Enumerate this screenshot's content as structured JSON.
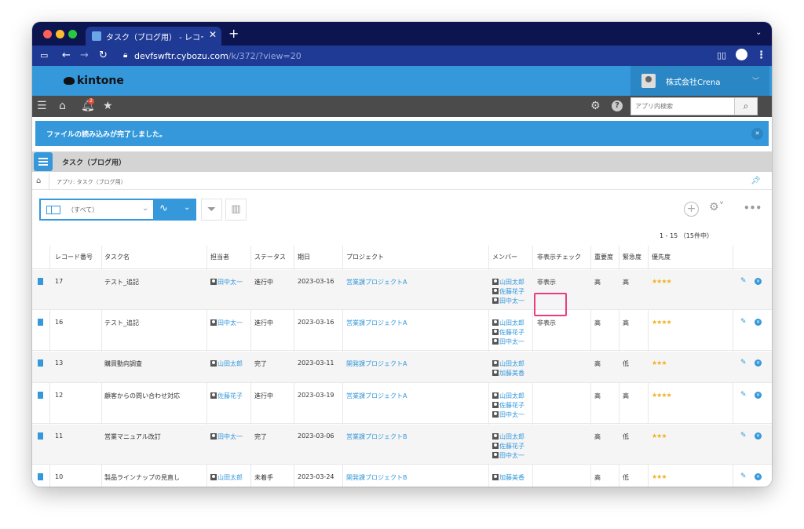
{
  "browser": {
    "tab_title": "タスク（ブログ用） - レコードの一覧",
    "tab_close": "✕",
    "new_tab": "+",
    "url_host": "devfswftr.cybozu.com",
    "url_path": "/k/372/?view=20"
  },
  "header": {
    "logo": "kintone",
    "company": "株式会社Crena",
    "notification_count": "2",
    "search_placeholder": "アプリ内検索"
  },
  "notice": {
    "text": "ファイルの読み込みが完了しました。"
  },
  "app": {
    "title": "タスク（ブログ用）",
    "breadcrumb": "アプリ: タスク（ブログ用）"
  },
  "view": {
    "selected": "（すべて）",
    "pager": "1 - 15 （15件中）"
  },
  "table": {
    "headers": [
      "レコード番号",
      "タスク名",
      "担当者",
      "ステータス",
      "期日",
      "プロジェクト",
      "メンバー",
      "非表示チェック",
      "重要度",
      "緊急度",
      "優先度"
    ],
    "rows": [
      {
        "id": "17",
        "task": "テスト_追記",
        "owner": "田中太一",
        "status": "進行中",
        "due": "2023-03-16",
        "project": "営業課プロジェクトA",
        "members": [
          "山田太郎",
          "佐藤花子",
          "田中太一"
        ],
        "hidden": "非表示",
        "importance": "高",
        "urgency": "高",
        "priority": "★★★★"
      },
      {
        "id": "16",
        "task": "テスト_追記",
        "owner": "田中太一",
        "status": "進行中",
        "due": "2023-03-16",
        "project": "営業課プロジェクトA",
        "members": [
          "山田太郎",
          "佐藤花子",
          "田中太一"
        ],
        "hidden": "非表示",
        "importance": "高",
        "urgency": "高",
        "priority": "★★★★"
      },
      {
        "id": "13",
        "task": "購買動向調査",
        "owner": "山田太郎",
        "status": "完了",
        "due": "2023-03-11",
        "project": "開発課プロジェクトA",
        "members": [
          "山田太郎",
          "加藤美香"
        ],
        "hidden": "",
        "importance": "高",
        "urgency": "低",
        "priority": "★★★"
      },
      {
        "id": "12",
        "task": "顧客からの問い合わせ対応",
        "owner": "佐藤花子",
        "status": "進行中",
        "due": "2023-03-19",
        "project": "営業課プロジェクトA",
        "members": [
          "山田太郎",
          "佐藤花子",
          "田中太一"
        ],
        "hidden": "",
        "importance": "高",
        "urgency": "高",
        "priority": "★★★★"
      },
      {
        "id": "11",
        "task": "営業マニュアル改訂",
        "owner": "田中太一",
        "status": "完了",
        "due": "2023-03-06",
        "project": "営業課プロジェクトB",
        "members": [
          "山田太郎",
          "佐藤花子",
          "田中太一"
        ],
        "hidden": "",
        "importance": "高",
        "urgency": "低",
        "priority": "★★★"
      },
      {
        "id": "10",
        "task": "製品ラインナップの見直し",
        "owner": "山田太郎",
        "status": "未着手",
        "due": "2023-03-24",
        "project": "開発課プロジェクトB",
        "members": [
          "加藤美香"
        ],
        "hidden": "",
        "importance": "高",
        "urgency": "低",
        "priority": "★★★"
      }
    ]
  },
  "colors": {
    "accent": "#3498db",
    "highlight": "#e83e80",
    "star": "#f2b01e"
  }
}
